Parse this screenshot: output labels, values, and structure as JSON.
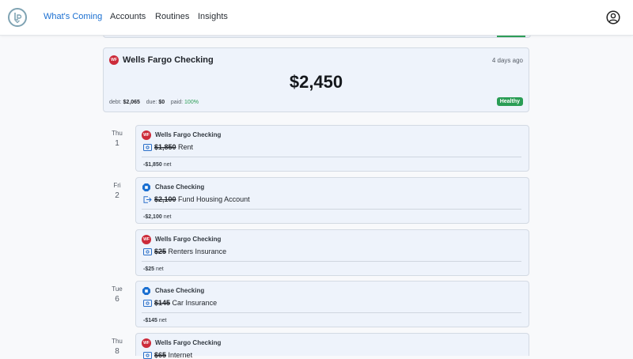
{
  "nav": {
    "items": [
      {
        "label": "What's Coming",
        "active": true
      },
      {
        "label": "Accounts"
      },
      {
        "label": "Routines"
      },
      {
        "label": "Insights"
      }
    ]
  },
  "account_card": {
    "name": "Wells Fargo Checking",
    "icon_text": "WF",
    "age": "4 days ago",
    "balance": "$2,450",
    "debt_label": "debt:",
    "debt": "$2,065",
    "due_label": "due:",
    "due": "$0",
    "paid_label": "paid:",
    "paid": "100%",
    "status": "Healthy"
  },
  "days": [
    {
      "dow": "Thu",
      "num": "1"
    },
    {
      "dow": "Fri",
      "num": "2"
    },
    {
      "dow": "Tue",
      "num": "6"
    },
    {
      "dow": "Thu",
      "num": "8"
    }
  ],
  "transactions": [
    {
      "account": "Wells Fargo Checking",
      "bank": "wf",
      "icon_text": "WF",
      "type": "bill-icon",
      "amount": "$1,850",
      "name": "Rent",
      "net": "-$1,850",
      "net_label": "net"
    },
    {
      "account": "Chase Checking",
      "bank": "chase",
      "icon_text": "",
      "type": "transfer-icon",
      "amount": "$2,100",
      "name": "Fund Housing Account",
      "net": "-$2,100",
      "net_label": "net"
    },
    {
      "account": "Wells Fargo Checking",
      "bank": "wf",
      "icon_text": "WF",
      "type": "bill-icon",
      "amount": "$25",
      "name": "Renters Insurance",
      "net": "-$25",
      "net_label": "net"
    },
    {
      "account": "Chase Checking",
      "bank": "chase",
      "icon_text": "",
      "type": "bill-icon",
      "amount": "$145",
      "name": "Car Insurance",
      "net": "-$145",
      "net_label": "net"
    },
    {
      "account": "Wells Fargo Checking",
      "bank": "wf",
      "icon_text": "WF",
      "type": "bill-icon",
      "amount": "$65",
      "name": "Internet",
      "net": "",
      "net_label": ""
    }
  ],
  "colors": {
    "accent": "#1a6fd1",
    "healthy": "#2a9d55",
    "wells_fargo": "#cc2b3a",
    "chase": "#1a6fd1"
  }
}
